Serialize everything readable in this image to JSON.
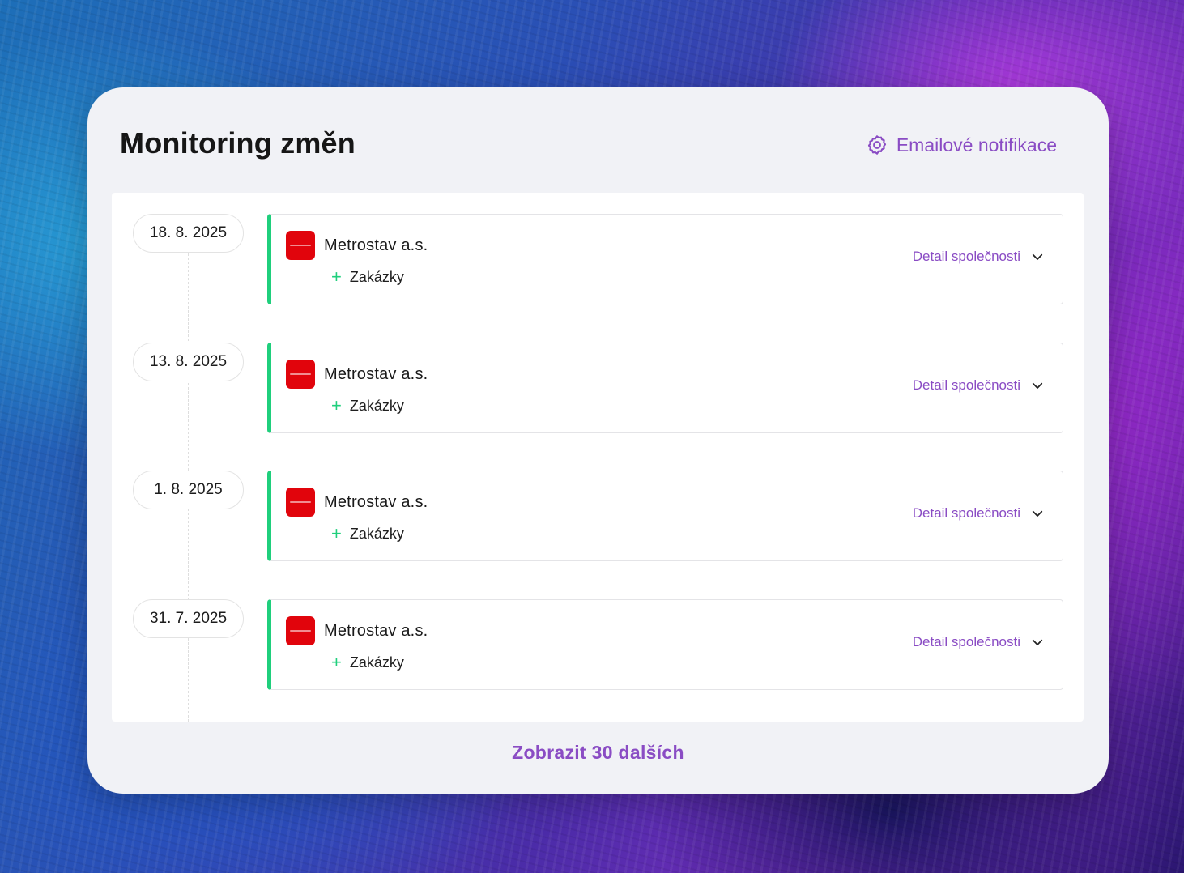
{
  "header": {
    "title": "Monitoring změn",
    "notifications_label": "Emailové notifikace"
  },
  "entries": [
    {
      "date": "18. 8. 2025",
      "company": "Metrostav a.s.",
      "change": "Zakázky",
      "detail_label": "Detail společnosti"
    },
    {
      "date": "13. 8. 2025",
      "company": "Metrostav a.s.",
      "change": "Zakázky",
      "detail_label": "Detail společnosti"
    },
    {
      "date": "1. 8. 2025",
      "company": "Metrostav a.s.",
      "change": "Zakázky",
      "detail_label": "Detail společnosti"
    },
    {
      "date": "31. 7. 2025",
      "company": "Metrostav a.s.",
      "change": "Zakázky",
      "detail_label": "Detail společnosti"
    }
  ],
  "footer": {
    "more_label": "Zobrazit 30 dalších"
  },
  "colors": {
    "accent": "#8a4cc4",
    "change_marker": "#1fcf7c",
    "logo_red": "#e1040c"
  },
  "icons": {
    "notifications": "gear-icon",
    "change": "plus-icon",
    "detail": "chevron-down-icon"
  }
}
